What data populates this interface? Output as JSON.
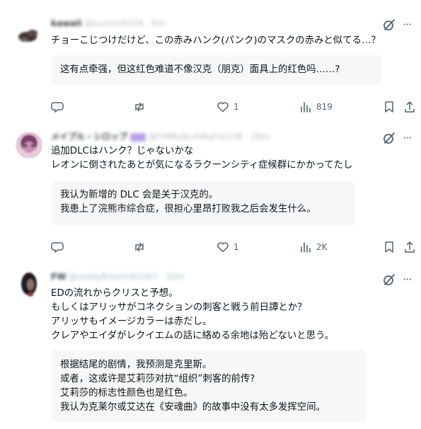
{
  "colors": {
    "icon": "#536471",
    "text": "#0f1419",
    "box_bg": "#f7f7f8",
    "divider": "#eff3f4"
  },
  "tweets": [
    {
      "author": "kawaii",
      "handle": "@sumire0204 · 6m",
      "text": "チョーこじつけだけど、この赤みハンク(パンク)のマスクの赤みと似てる…？",
      "translation": "这有点牵强，但这红色难道不像汉克（朋克）面具上的红色吗……?",
      "stats": {
        "replies": "",
        "retweets": "",
        "likes": "1",
        "views": "819"
      }
    },
    {
      "author": "メイプル・シロップ",
      "handle": "@OMRoNn4iNqOd2O8 · 28m",
      "text": "追加DLCはハンク？じゃないかな\nレオンに倒されたあとが気になるラクーンシティ症候群にかかってたし",
      "translation": "我认为新增的 DLC 会是关于汉克的。\n我患上了浣熊市综合症，很担心里昂打败我之后会发生什么。",
      "stats": {
        "replies": "",
        "retweets": "",
        "likes": "1",
        "views": "2K"
      }
    },
    {
      "author": "FW",
      "handle": "@roddyRiteOrdOO07 · 20m",
      "text": "EDの流れからクリスと予想。\nもしくはアリッサがコネクションの刺客と戦う前日譚とか？\nアリッサもイメージカラーは赤だし。\nクレアやエイダがレクイエムの話に絡める余地は殆どないと思う。",
      "translation": "根据结尾的剧情，我预测是克里斯。\n或者，这或许是艾莉莎对抗“组织”刺客的前传?\n艾莉莎的标志性颜色也是红色。\n我认为克莱尔或艾达在《安魂曲》的故事中没有太多发挥空间。",
      "stats": {
        "replies": "",
        "retweets": "",
        "likes": "",
        "views": ""
      }
    }
  ]
}
